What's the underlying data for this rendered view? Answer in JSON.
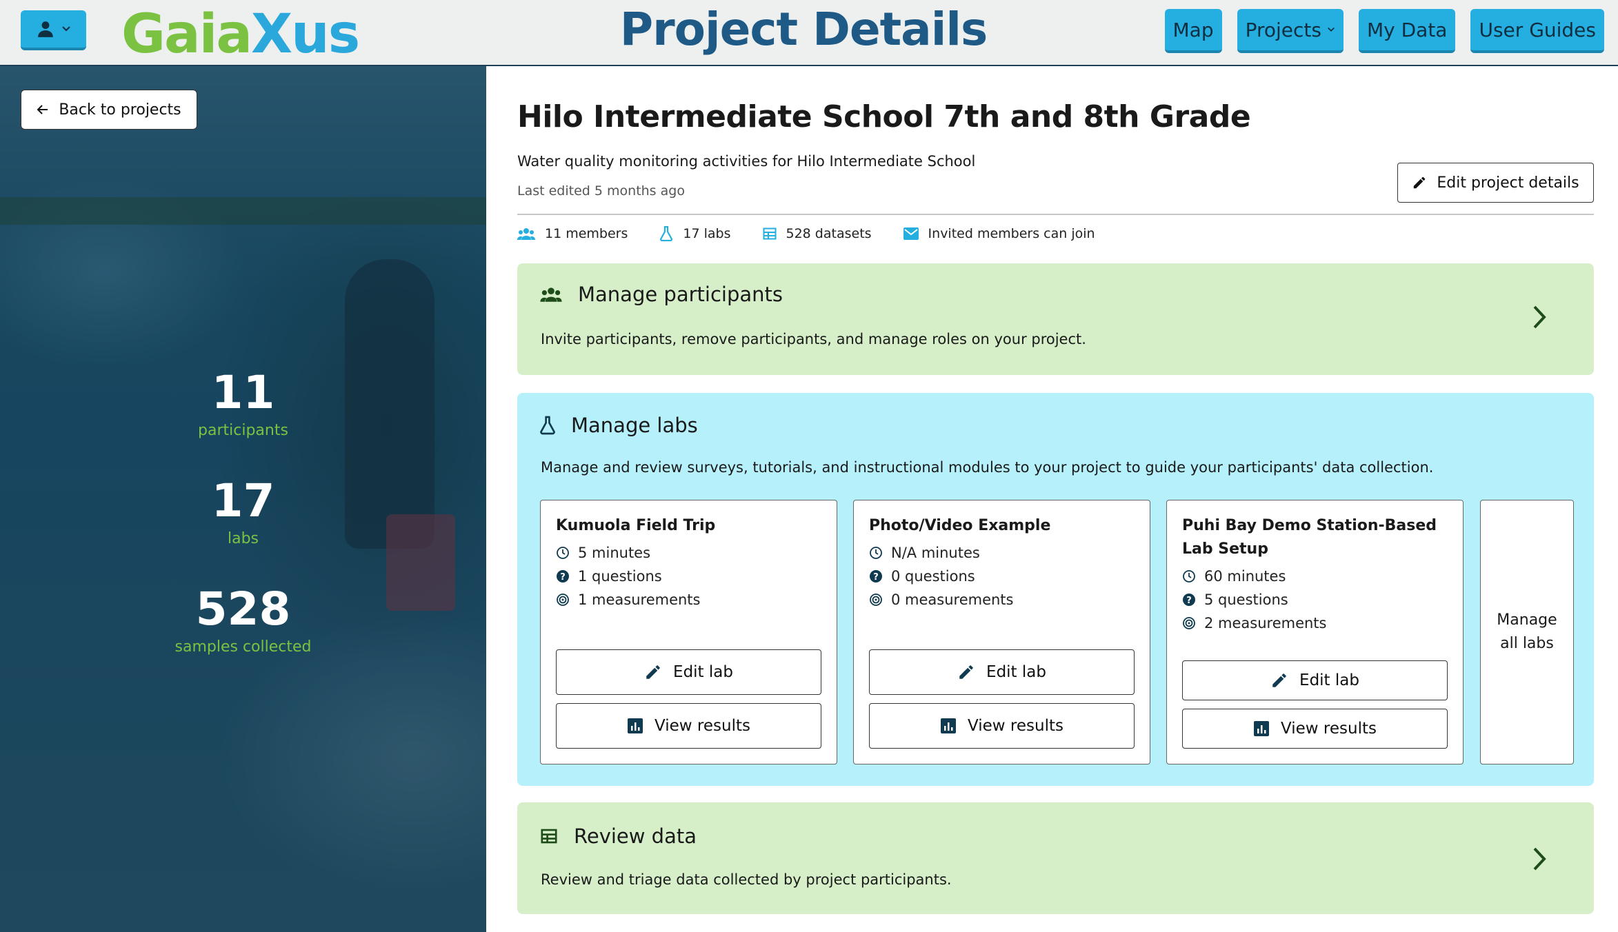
{
  "header": {
    "logo_part1": "Gaia",
    "logo_part2": "Xus",
    "title": "Project Details",
    "nav": [
      {
        "label": "Map"
      },
      {
        "label": "Projects"
      },
      {
        "label": "My Data"
      },
      {
        "label": "User Guides"
      }
    ]
  },
  "sidebar": {
    "back_label": "Back to projects",
    "stats": [
      {
        "value": "11",
        "label": "participants"
      },
      {
        "value": "17",
        "label": "labs"
      },
      {
        "value": "528",
        "label": "samples collected"
      }
    ]
  },
  "project": {
    "title": "Hilo Intermediate School 7th and 8th Grade",
    "description": "Water quality monitoring activities for Hilo Intermediate School",
    "last_edited": "Last edited 5 months ago",
    "edit_label": "Edit project details",
    "meta": {
      "members": "11 members",
      "labs": "17 labs",
      "datasets": "528 datasets",
      "join": "Invited members can join"
    }
  },
  "participants_panel": {
    "title": "Manage participants",
    "description": "Invite participants, remove participants, and manage roles on your project."
  },
  "labs_panel": {
    "title": "Manage labs",
    "description": "Manage and review surveys, tutorials, and instructional modules to your project to guide your participants' data collection.",
    "edit_label": "Edit lab",
    "view_label": "View results",
    "manage_all": "Manage all labs",
    "labs": [
      {
        "name": "Kumuola Field Trip",
        "minutes": "5 minutes",
        "questions": "1 questions",
        "measurements": "1 measurements"
      },
      {
        "name": "Photo/Video Example",
        "minutes": "N/A minutes",
        "questions": "0 questions",
        "measurements": "0 measurements"
      },
      {
        "name": "Puhi Bay Demo Station-Based Lab Setup",
        "minutes": "60 minutes",
        "questions": "5 questions",
        "measurements": "2 measurements"
      }
    ]
  },
  "data_panel": {
    "title": "Review data",
    "description": "Review and triage data collected by project participants."
  },
  "colors": {
    "accent_blue": "#25aee0",
    "title_blue": "#1e5a85",
    "logo_green": "#7cc242",
    "panel_green": "#d6efc9",
    "panel_cyan": "#b5f0fb"
  },
  "icons": [
    "user-icon",
    "chevron-down-icon",
    "arrow-left-icon",
    "pencil-icon",
    "people-icon",
    "flask-icon",
    "table-icon",
    "mail-icon",
    "chevron-right-icon",
    "clock-icon",
    "question-icon",
    "target-icon",
    "bar-chart-icon"
  ]
}
